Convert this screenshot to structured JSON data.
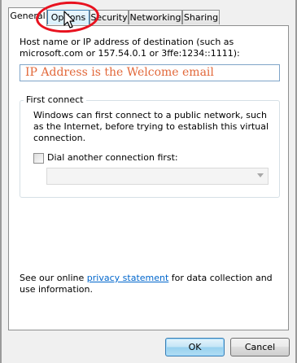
{
  "tabs": [
    {
      "label": "General",
      "active": true
    },
    {
      "label": "Options",
      "active": false,
      "hover": true
    },
    {
      "label": "Security",
      "active": false
    },
    {
      "label": "Networking",
      "active": false
    },
    {
      "label": "Sharing",
      "active": false
    }
  ],
  "general": {
    "host_label": "Host name or IP address of destination (such as microsoft.com or 157.54.0.1 or 3ffe:1234::1111):",
    "host_value": "IP Address is the Welcome email",
    "first_connect": {
      "title": "First connect",
      "description": "Windows can first connect to a public network, such as the Internet, before trying to establish this virtual connection.",
      "checkbox_label": "Dial another connection first:",
      "checkbox_checked": false,
      "combo_value": ""
    },
    "privacy": {
      "prefix": "See our online ",
      "link": "privacy statement",
      "suffix": " for data collection and use information."
    }
  },
  "buttons": {
    "ok": "OK",
    "cancel": "Cancel"
  },
  "colors": {
    "annotation_ring": "#e8121f",
    "input_text": "#e2683a",
    "link": "#0066cc"
  },
  "icons": {
    "cursor": "mouse-pointer-icon",
    "combo_arrow": "chevron-down-icon"
  }
}
